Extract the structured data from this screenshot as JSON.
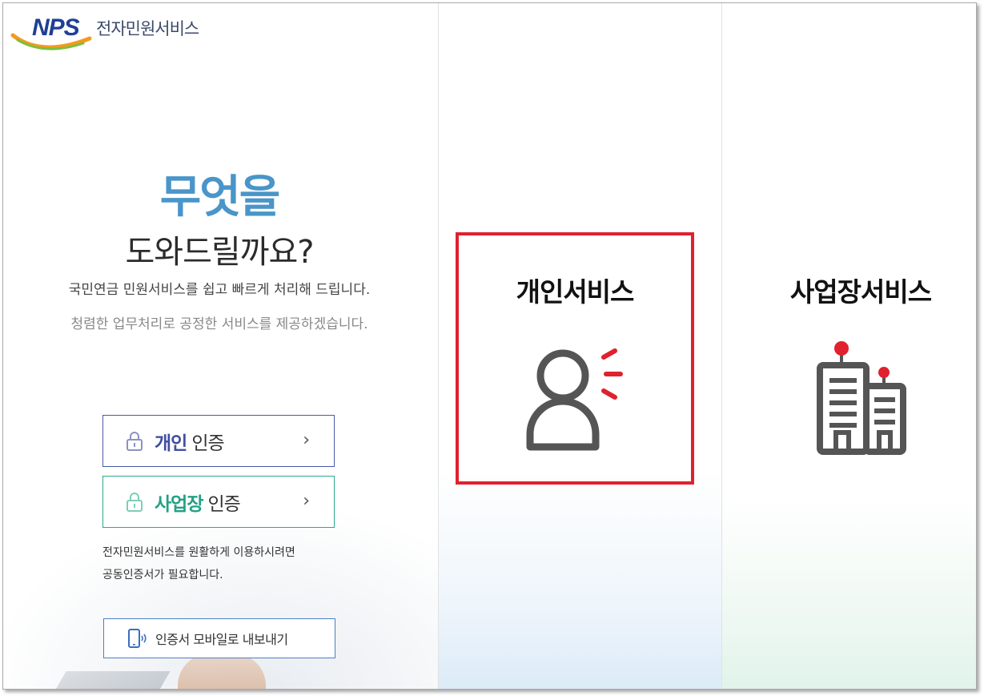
{
  "logo": {
    "brand": "NPS",
    "service_name": "전자민원서비스"
  },
  "hero": {
    "headline_1": "무엇을",
    "headline_2": "도와드릴까요?",
    "description_1": "국민연금 민원서비스를 쉽고 빠르게 처리해 드립니다.",
    "description_2": "청렴한 업무처리로 공정한 서비스를 제공하겠습니다."
  },
  "auth": {
    "personal": {
      "highlight": "개인",
      "rest": "인증",
      "chevron": "›"
    },
    "business": {
      "highlight": "사업장",
      "rest": "인증",
      "chevron": "›"
    },
    "notice_line_1": "전자민원서비스를 원활하게 이용하시려면",
    "notice_line_2": "공동인증서가 필요합니다."
  },
  "export": {
    "label": "인증서 모바일로 내보내기"
  },
  "services": {
    "personal": {
      "title": "개인서비스",
      "icon": "person-icon"
    },
    "business": {
      "title": "사업장서비스",
      "icon": "building-icon"
    }
  },
  "colors": {
    "headline": "#4a95c9",
    "personal_accent": "#3f4fa0",
    "business_accent": "#22a184",
    "highlight_box": "#e0212e",
    "icon_gray": "#555555",
    "icon_red": "#e0212e"
  }
}
